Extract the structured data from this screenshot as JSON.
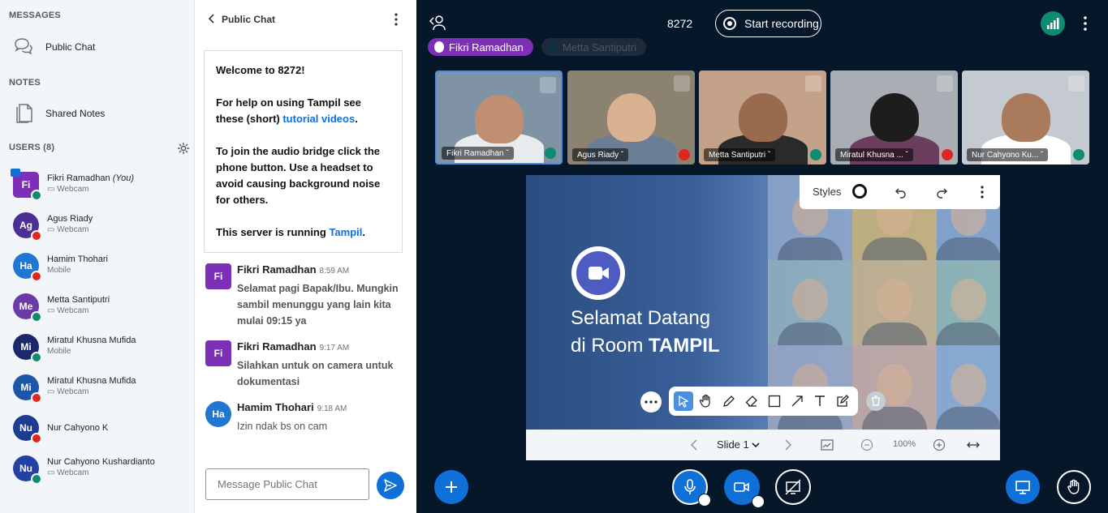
{
  "sidebar": {
    "messages_title": "MESSAGES",
    "public_chat_label": "Public Chat",
    "notes_title": "NOTES",
    "shared_notes_label": "Shared Notes",
    "users_title": "USERS (8)",
    "users": [
      {
        "initials": "Fi",
        "name": "Fikri Ramadhan",
        "you": "(You)",
        "sub": "Webcam",
        "color": "#7D30B7",
        "status": "on"
      },
      {
        "initials": "Ag",
        "name": "Agus Riady",
        "sub": "Webcam",
        "color": "#4B2F92",
        "status": "muted"
      },
      {
        "initials": "Ha",
        "name": "Hamim Thohari",
        "sub": "Mobile",
        "color": "#2076D3",
        "status": "muted"
      },
      {
        "initials": "Me",
        "name": "Metta Santiputri",
        "sub": "Webcam",
        "color": "#6A3AA6",
        "status": "on"
      },
      {
        "initials": "Mi",
        "name": "Miratul Khusna Mufida",
        "sub": "Mobile",
        "color": "#19296B",
        "status": "on"
      },
      {
        "initials": "Mi",
        "name": "Miratul Khusna Mufida",
        "sub": "Webcam",
        "color": "#1C56A8",
        "status": "muted"
      },
      {
        "initials": "Nu",
        "name": "Nur Cahyono K",
        "sub": "",
        "color": "#1E3C8F",
        "status": "muted"
      },
      {
        "initials": "Nu",
        "name": "Nur Cahyono Kushardianto",
        "sub": "Webcam",
        "color": "#2340A4",
        "status": "on"
      }
    ]
  },
  "chat": {
    "title": "Public Chat",
    "welcome_line": "Welcome to 8272!",
    "help_pre": "For help on using Tampil see these (short) ",
    "help_link": "tutorial videos",
    "help_post": ".",
    "audio_text": "To join the audio bridge click the phone button. Use a headset to avoid causing background noise for others.",
    "server_pre": "This server is running ",
    "server_link": "Tampil",
    "server_post": ".",
    "messages": [
      {
        "initials": "Fi",
        "author": "Fikri Ramadhan",
        "time": "8:59 AM",
        "text": "Selamat pagi Bapak/Ibu. Mungkin sambil menunggu yang lain kita mulai 09:15 ya"
      },
      {
        "initials": "Fi",
        "author": "Fikri Ramadhan",
        "time": "9:17 AM",
        "text": "Silahkan untuk on camera untuk dokumentasi"
      },
      {
        "initials": "Ha",
        "author": "Hamim Thohari",
        "time": "9:18 AM",
        "text": "Izin ndak bs on cam"
      }
    ],
    "input_placeholder": "Message Public Chat"
  },
  "main": {
    "room_number": "8272",
    "record_label": "Start recording",
    "talkers": [
      "Fikri Ramadhan",
      "Metta Santiputri"
    ],
    "tiles": [
      {
        "name": "Fikri Ramadhan ˇ",
        "bg": "#7F93A5",
        "skin": "#C08E70",
        "shirt": "#E8ECEF"
      },
      {
        "name": "Agus Riady ˇ",
        "bg": "#8C8272",
        "skin": "#D8B190",
        "shirt": "#6A7E96"
      },
      {
        "name": "Metta Santiputri ˇ",
        "bg": "#C3A289",
        "skin": "#9A6A4F",
        "shirt": "#2A2A2A"
      },
      {
        "name": "Miratul Khusna ... ˇ",
        "bg": "#A9AEB5",
        "skin": "#1D1D1D",
        "shirt": "#6A3E5C"
      },
      {
        "name": "Nur Cahyono Ku... ˇ",
        "bg": "#C5CAD0",
        "skin": "#A97A5C",
        "shirt": "#FFFFFF"
      }
    ],
    "slide": {
      "title_line1": "Selamat Datang",
      "title_line2_pre": "di Room ",
      "title_line2_bold": "TAMPIL",
      "styles_label": "Styles",
      "slide_label": "Slide 1",
      "zoom": "100%"
    }
  }
}
